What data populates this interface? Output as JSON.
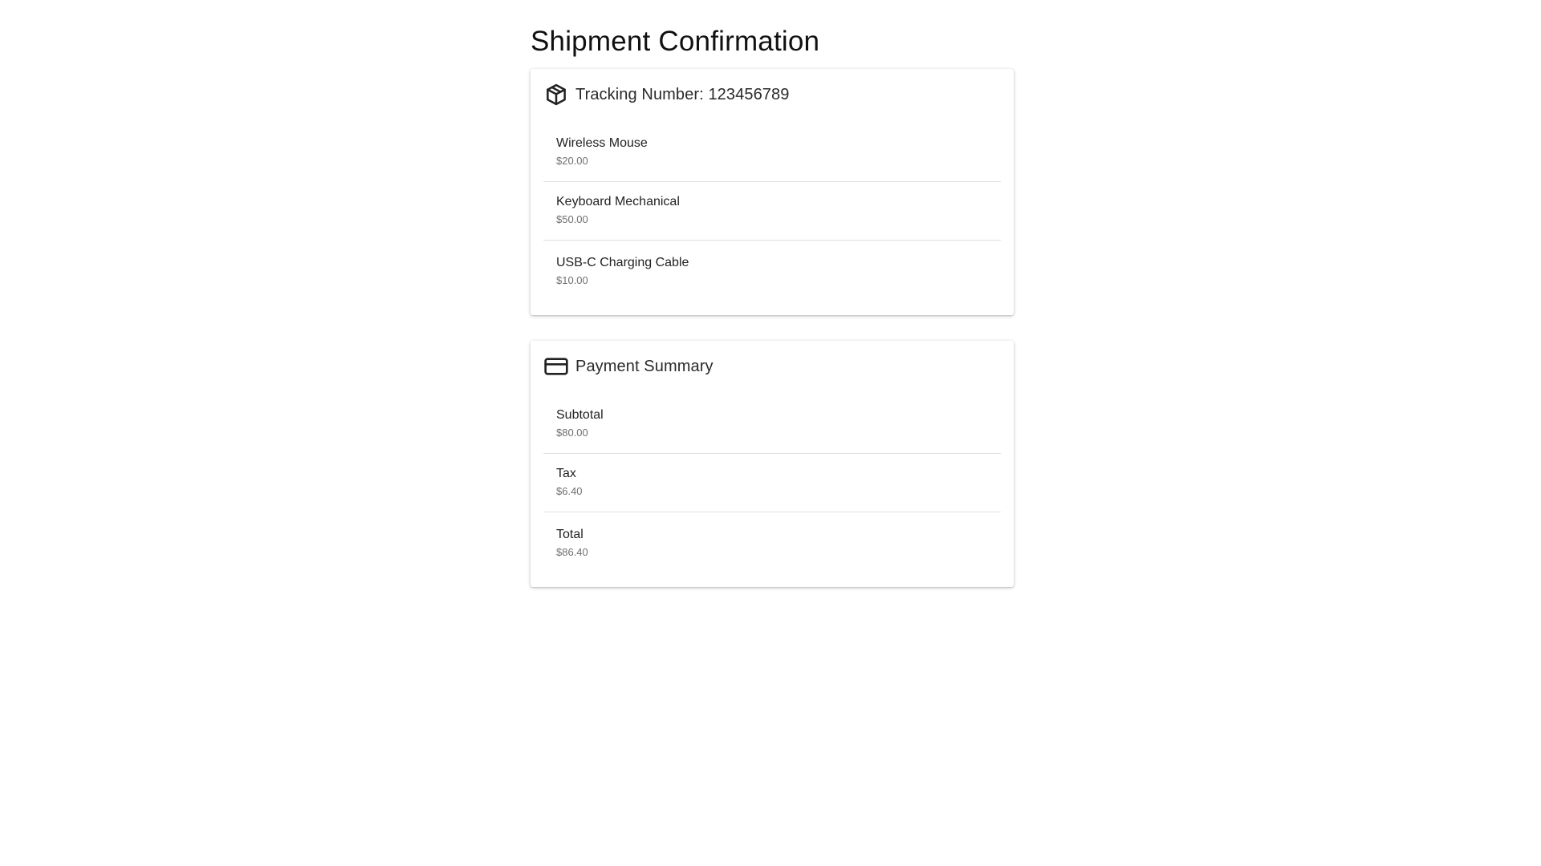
{
  "page": {
    "title": "Shipment Confirmation"
  },
  "tracking": {
    "icon": "package-icon",
    "title": "Tracking Number: 123456789",
    "items": [
      {
        "name": "Wireless Mouse",
        "price": "$20.00"
      },
      {
        "name": "Keyboard Mechanical",
        "price": "$50.00"
      },
      {
        "name": "USB-C Charging Cable",
        "price": "$10.00"
      }
    ]
  },
  "payment": {
    "icon": "credit-card-icon",
    "title": "Payment Summary",
    "rows": [
      {
        "label": "Subtotal",
        "value": "$80.00"
      },
      {
        "label": "Tax",
        "value": "$6.40"
      },
      {
        "label": "Total",
        "value": "$86.40"
      }
    ]
  },
  "colors": {
    "text_primary": "#222222",
    "text_secondary": "#6f6f6f",
    "divider": "#e0e0e0",
    "background": "#ffffff"
  }
}
